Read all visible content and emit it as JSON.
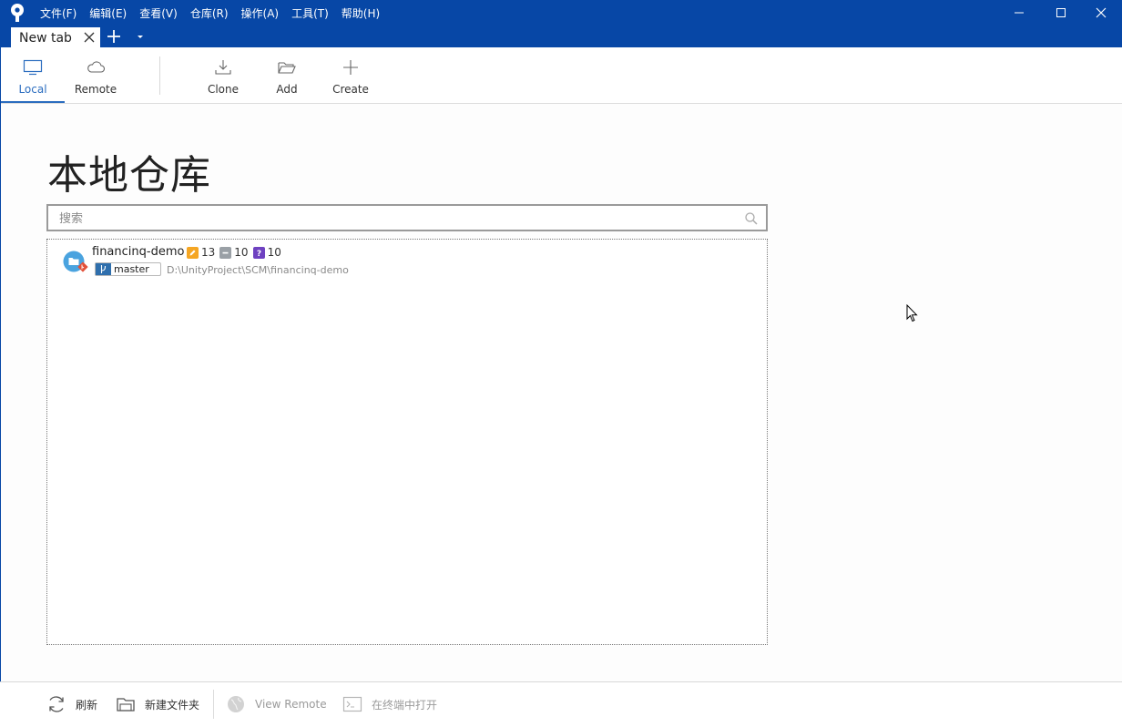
{
  "menu": [
    "文件(F)",
    "编辑(E)",
    "查看(V)",
    "仓库(R)",
    "操作(A)",
    "工具(T)",
    "帮助(H)"
  ],
  "tab": {
    "label": "New tab"
  },
  "toolbar": {
    "local": "Local",
    "remote": "Remote",
    "clone": "Clone",
    "add": "Add",
    "create": "Create"
  },
  "page_title": "本地仓库",
  "search": {
    "placeholder": "搜索",
    "value": ""
  },
  "repos": [
    {
      "name": "financinq-demo",
      "modified": "13",
      "removed": "10",
      "untracked": "10",
      "branch": "master",
      "path": "D:\\UnityProject\\SCM\\financinq-demo"
    }
  ],
  "bottom": {
    "refresh": "刷新",
    "new_folder": "新建文件夹",
    "view_remote": "View Remote",
    "open_terminal": "在终端中打开"
  },
  "colors": {
    "titlebar": "#0747a6",
    "accent": "#2b6dbf",
    "modified_badge": "#f5a623",
    "removed_badge": "#9aa0a6",
    "untracked_badge": "#6f42c1",
    "branch_badge": "#2f6fad"
  }
}
